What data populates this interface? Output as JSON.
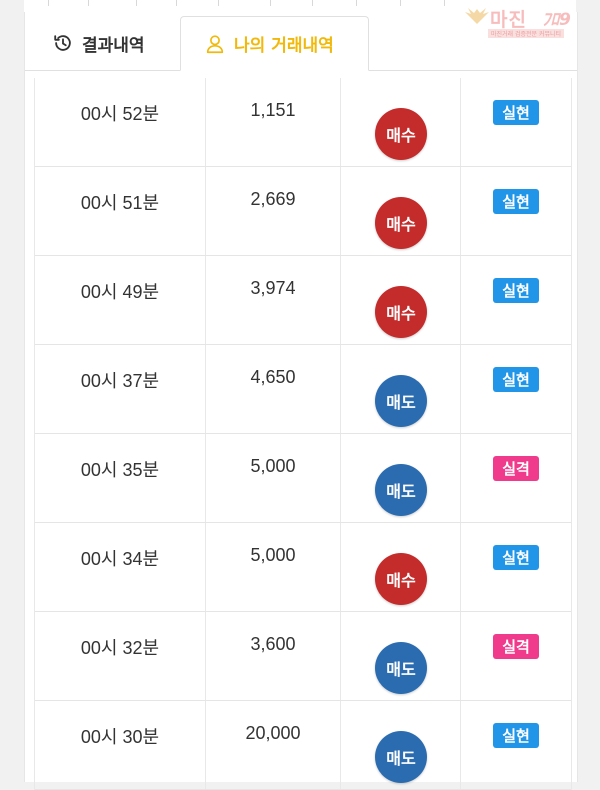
{
  "watermark": {
    "logo_text": "마진",
    "subtitle": "마진거래 검증전문 커뮤니티"
  },
  "tabs": [
    {
      "label": "결과내역",
      "icon": "history-icon",
      "active": false
    },
    {
      "label": "나의 거래내역",
      "icon": "user-icon",
      "active": true
    }
  ],
  "colors": {
    "active_tab": "#f0b90b",
    "buy": "#c42b2b",
    "sell": "#2b6cb0",
    "success": "#2196e9",
    "fail": "#f03a8c"
  },
  "rows": [
    {
      "time": "00시 52분",
      "amount": "1,151",
      "side": "매수",
      "side_type": "buy",
      "status": "실현",
      "status_type": "success"
    },
    {
      "time": "00시 51분",
      "amount": "2,669",
      "side": "매수",
      "side_type": "buy",
      "status": "실현",
      "status_type": "success"
    },
    {
      "time": "00시 49분",
      "amount": "3,974",
      "side": "매수",
      "side_type": "buy",
      "status": "실현",
      "status_type": "success"
    },
    {
      "time": "00시 37분",
      "amount": "4,650",
      "side": "매도",
      "side_type": "sell",
      "status": "실현",
      "status_type": "success"
    },
    {
      "time": "00시 35분",
      "amount": "5,000",
      "side": "매도",
      "side_type": "sell",
      "status": "실격",
      "status_type": "fail"
    },
    {
      "time": "00시 34분",
      "amount": "5,000",
      "side": "매수",
      "side_type": "buy",
      "status": "실현",
      "status_type": "success"
    },
    {
      "time": "00시 32분",
      "amount": "3,600",
      "side": "매도",
      "side_type": "sell",
      "status": "실격",
      "status_type": "fail"
    },
    {
      "time": "00시 30분",
      "amount": "20,000",
      "side": "매도",
      "side_type": "sell",
      "status": "실현",
      "status_type": "success"
    }
  ]
}
